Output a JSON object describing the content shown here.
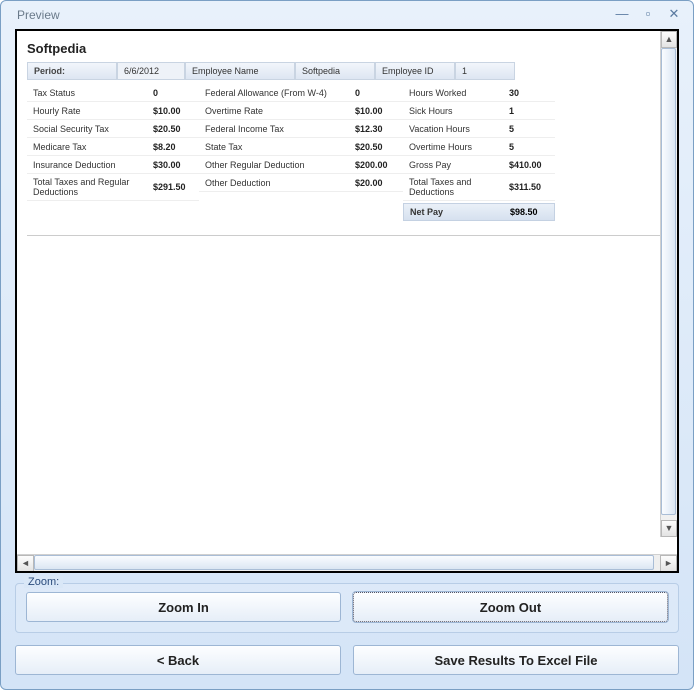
{
  "window": {
    "title": "Preview"
  },
  "company": "Softpedia",
  "header": {
    "period_label": "Period:",
    "period_value": "6/6/2012",
    "empname_label": "Employee Name",
    "empname_value": "Softpedia",
    "empid_label": "Employee ID",
    "empid_value": "1"
  },
  "col1": [
    {
      "label": "Tax Status",
      "value": "0"
    },
    {
      "label": "Hourly Rate",
      "value": "$10.00"
    },
    {
      "label": "Social Security Tax",
      "value": "$20.50"
    },
    {
      "label": "Medicare Tax",
      "value": "$8.20"
    },
    {
      "label": "Insurance Deduction",
      "value": "$30.00"
    },
    {
      "label": "Total Taxes and Regular Deductions",
      "value": "$291.50"
    }
  ],
  "col2": [
    {
      "label": "Federal Allowance (From W-4)",
      "value": "0"
    },
    {
      "label": "Overtime Rate",
      "value": "$10.00"
    },
    {
      "label": "Federal Income Tax",
      "value": "$12.30"
    },
    {
      "label": "State Tax",
      "value": "$20.50"
    },
    {
      "label": "Other Regular Deduction",
      "value": "$200.00"
    },
    {
      "label": "Other Deduction",
      "value": "$20.00"
    }
  ],
  "col3": [
    {
      "label": "Hours Worked",
      "value": "30"
    },
    {
      "label": "Sick Hours",
      "value": "1"
    },
    {
      "label": "Vacation Hours",
      "value": "5"
    },
    {
      "label": "Overtime Hours",
      "value": "5"
    },
    {
      "label": "Gross Pay",
      "value": "$410.00"
    },
    {
      "label": "Total Taxes and Deductions",
      "value": "$311.50"
    }
  ],
  "netpay": {
    "label": "Net Pay",
    "value": "$98.50"
  },
  "zoom": {
    "legend": "Zoom:",
    "in": "Zoom In",
    "out": "Zoom Out"
  },
  "bottom": {
    "back": "< Back",
    "save": "Save Results To Excel File"
  }
}
